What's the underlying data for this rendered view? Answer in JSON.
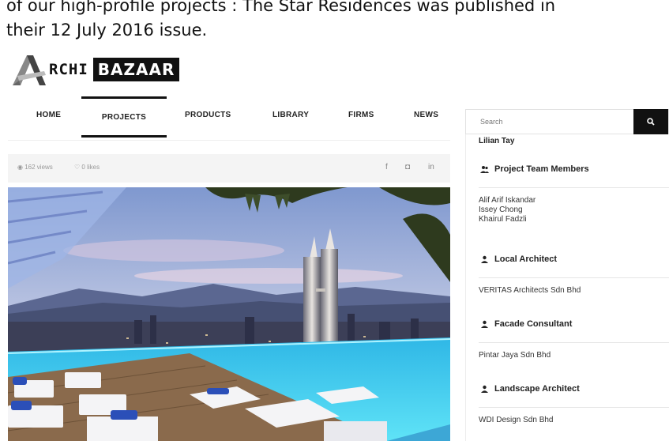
{
  "intro": {
    "line1": "of our high-profile projects : The Star Residences was published in",
    "line2": "their 12 July 2016 issue."
  },
  "logo": {
    "part1": "RCHI",
    "part2": "BAZAAR",
    "mark_letter": "A"
  },
  "nav": {
    "items": [
      {
        "label": "HOME",
        "active": false
      },
      {
        "label": "PROJECTS",
        "active": true
      },
      {
        "label": "PRODUCTS",
        "active": false
      },
      {
        "label": "LIBRARY",
        "active": false
      },
      {
        "label": "FIRMS",
        "active": false
      },
      {
        "label": "NEWS",
        "active": false
      }
    ]
  },
  "stats": {
    "views": "162 views",
    "likes": "0 likes"
  },
  "share": {
    "facebook": "f",
    "instagram": "◘",
    "linkedin": "in"
  },
  "search": {
    "placeholder": "Search",
    "button_icon": "search-icon"
  },
  "sidebar": {
    "clipped_name": "Lilian Tay",
    "sections": [
      {
        "heading": "Project Team Members",
        "icon": "users-icon",
        "items": [
          "Alif Arif Iskandar",
          "Issey Chong",
          "Khairul Fadzli"
        ]
      },
      {
        "heading": "Local Architect",
        "icon": "user-icon",
        "items": [
          "VERITAS Architects Sdn Bhd"
        ]
      },
      {
        "heading": "Facade Consultant",
        "icon": "user-icon",
        "items": [
          "Pintar Jaya Sdn Bhd"
        ]
      },
      {
        "heading": "Landscape Architect",
        "icon": "user-icon",
        "items": [
          "WDI Design Sdn Bhd"
        ]
      }
    ]
  },
  "colors": {
    "accent": "#111111",
    "pool": "#4fd6f0",
    "sky": "#8fa9d8"
  }
}
